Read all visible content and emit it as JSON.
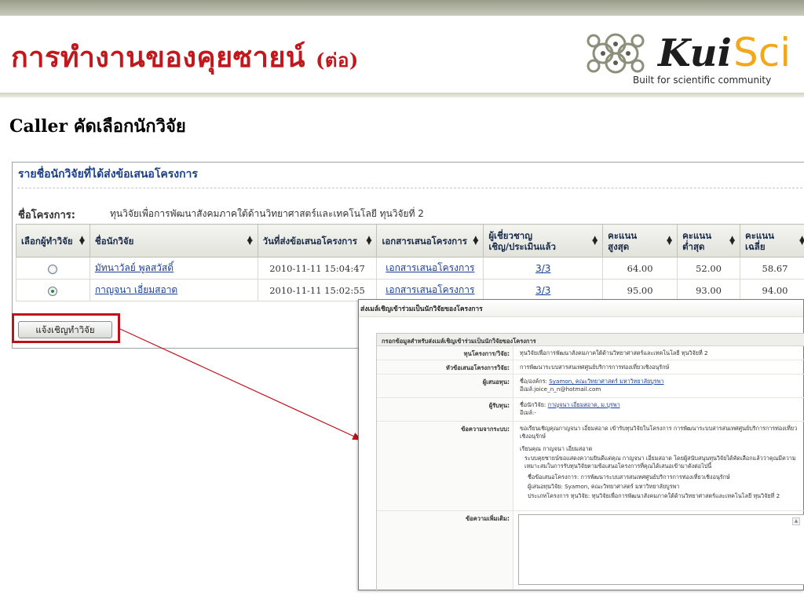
{
  "slide": {
    "title_main": "การทำงานของคุยซายน์",
    "title_suffix": "(ต่อ)",
    "subtitle": "Caller คัดเลือกนักวิจัย"
  },
  "logo": {
    "brand_kui": "Kui",
    "brand_sci": "Sci",
    "tagline": "Built for scientific community"
  },
  "panel": {
    "header": "รายชื่อนักวิจัยที่ได้ส่งข้อเสนอโครงการ",
    "project_label": "ชื่อโครงการ:",
    "project_value": "ทุนวิจัยเพื่อการพัฒนาสังคมภาคใต้ด้านวิทยาศาสตร์และเทคโนโลยี ทุนวิจัยที่ 2",
    "columns": [
      "เลือกผู้ทำวิจัย",
      "ชื่อนักวิจัย",
      "วันที่ส่งข้อเสนอโครงการ",
      "เอกสารเสนอโครงการ",
      "ผู้เชี่ยวชาญ\nเชิญ/ประเมินแล้ว",
      "คะแนน\nสูงสุด",
      "คะแนน\nต่ำสุด",
      "คะแนน\nเฉลี่ย"
    ],
    "rows": [
      {
        "name": "มัทนาวัลย์ พูลสวัสดิ์",
        "date": "2010-11-11 15:04:47",
        "doc": "เอกสารเสนอโครงการ",
        "experts": "3/3",
        "max": "64.00",
        "min": "52.00",
        "avg": "58.67",
        "selected": false
      },
      {
        "name": "กาญจนา เอี่ยมสอาด",
        "date": "2010-11-11 15:02:55",
        "doc": "เอกสารเสนอโครงการ",
        "experts": "3/3",
        "max": "95.00",
        "min": "93.00",
        "avg": "94.00",
        "selected": true
      }
    ],
    "invite_button": "แจ้งเชิญทำวิจัย"
  },
  "popup": {
    "title": "ส่งเมล์เชิญเข้าร่วมเป็นนักวิจัยของโครงการ",
    "section_header": "กรอกข้อมูลสำหรับส่งเมล์เชิญเข้าร่วมเป็นนักวิจัยของโครงการ",
    "fund_label": "ทุนโครงการ/วิจัย:",
    "fund_value": "ทุนวิจัยเพื่อการพัฒนาสังคมภาคใต้ด้านวิทยาศาสตร์และเทคโนโลยี ทุนวิจัยที่ 2",
    "topic_label": "หัวข้อเสนอโครงการวิจัย:",
    "topic_value": "การพัฒนาระบบสารสนเทศศูนย์บริการการท่องเที่ยวเชิงอนุรักษ์",
    "funder_label": "ผู้เสนอทุน:",
    "funder_name_prefix": "ชื่อ/องค์กร:",
    "funder_name_link": "Syamon, คณะวิทยาศาสตร์ มหาวิทยาลัยบูรพา",
    "funder_email": "อีเมล์:joice_n_n@hotmail.com",
    "recipient_label": "ผู้รับทุน:",
    "recipient_name_prefix": "ชื่อนักวิจัย:",
    "recipient_name_link": "กาญจนา เอี่ยมสอาด, ม.บูรพา",
    "recipient_email": "อีเมล์:-",
    "message_label": "ข้อความจากระบบ:",
    "message_line1": "ขอเรียนเชิญคุณกาญจนา เอี่ยมสอาด เข้ารับทุนวิจัยในโครงการ การพัฒนาระบบสารสนเทศศูนย์บริการการท่องเที่ยวเชิงอนุรักษ์",
    "message_line2": "เรียนคุณ กาญจนา เอี่ยมสอาด",
    "message_line3": "ระบบคุยซายน์ขอแสดงความยินดีแด่คุณ กาญจนา เอี่ยมสอาด โดยผู้สนับสนุนทุนวิจัยได้คัดเลือกแล้วว่าคุณมีความเหมาะสมในการรับทุนวิจัยตามข้อเสนอโครงการที่คุณได้เสนอเข้ามาดังต่อไปนี้",
    "message_line4": "ชื่อข้อเสนอโครงการ: การพัฒนาระบบสารสนเทศศูนย์บริการการท่องเที่ยวเชิงอนุรักษ์",
    "message_line5": "ผู้เสนอทุนวิจัย: Syamon, คณะวิทยาศาสตร์ มหาวิทยาลัยบูรพา",
    "message_line6": "ประเภทโครงการ ทุนวิจัย: ทุนวิจัยเพื่อการพัฒนาสังคมภาคใต้ด้านวิทยาศาสตร์และเทคโนโลยี ทุนวิจัยที่ 2",
    "extra_label": "ข้อความเพิ่มเติม:",
    "extra_value": ""
  },
  "colors": {
    "title_red": "#c0181c",
    "header_blue": "#1a3f86",
    "highlight_red": "#c0111b"
  }
}
